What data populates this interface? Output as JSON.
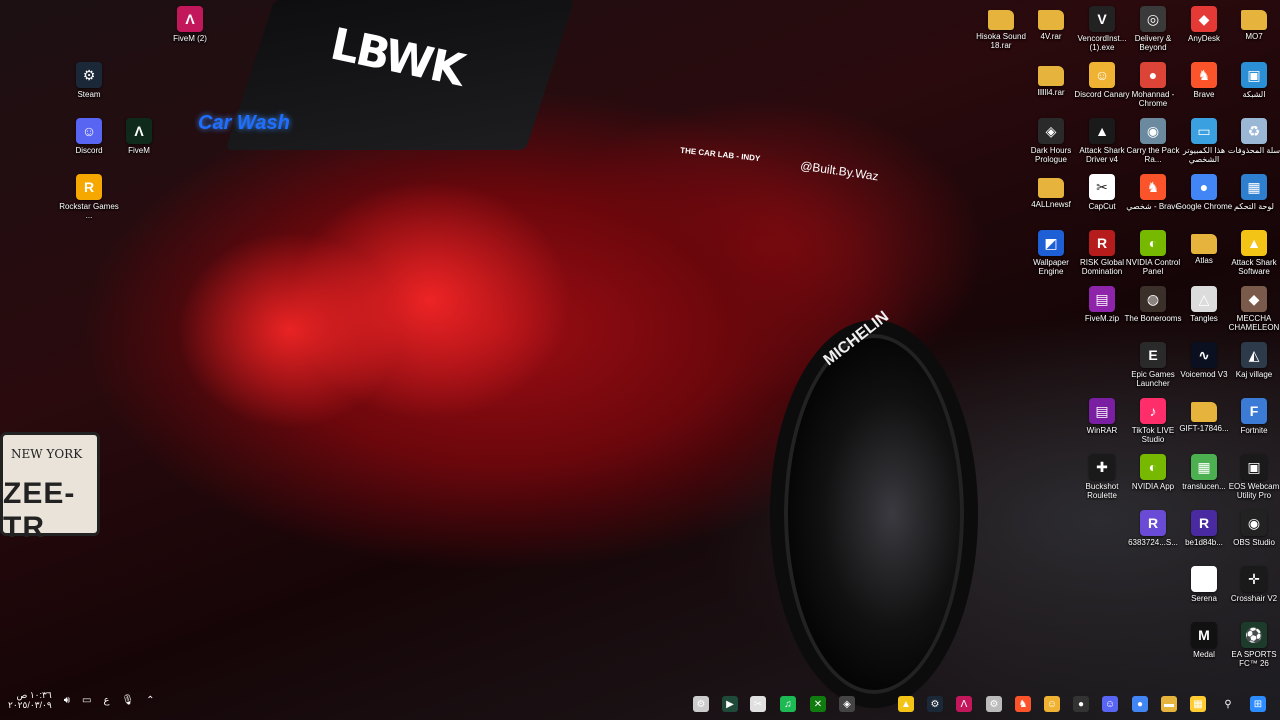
{
  "wallpaper": {
    "decal_brand": "LBWK",
    "decal_handle": "@Built.By.Waz",
    "decal_shop": "THE CAR LAB - INDY",
    "plate_state": "NEW YORK",
    "plate_number": "ZEE-TR",
    "tire_brand": "MICHELIN",
    "neon_sign": "Car Wash"
  },
  "desktop_icons": [
    {
      "id": "fivem2",
      "label": "FiveM (2)",
      "icon": "fivem-icon",
      "color": "#c2185b",
      "glyph": "Λ"
    },
    {
      "id": "steam",
      "label": "Steam",
      "icon": "steam-icon",
      "color": "#1b2838",
      "glyph": "⚙"
    },
    {
      "id": "discord",
      "label": "Discord",
      "icon": "discord-icon",
      "color": "#5865f2",
      "glyph": "☺"
    },
    {
      "id": "fivem",
      "label": "FiveM",
      "icon": "fivem-icon",
      "color": "#0f2a1a",
      "glyph": "Λ"
    },
    {
      "id": "rockstar",
      "label": "Rockstar Games ...",
      "icon": "rockstar-icon",
      "color": "#f6a800",
      "glyph": "R"
    },
    {
      "id": "hisoka",
      "label": "Hisoka Sound 18.rar",
      "icon": "folder-icon",
      "color": "#e6b43c",
      "glyph": ""
    },
    {
      "id": "4v",
      "label": "4V.rar",
      "icon": "folder-icon",
      "color": "#e6b43c",
      "glyph": ""
    },
    {
      "id": "vencord",
      "label": "VencordInst... (1).exe",
      "icon": "vencord-icon",
      "color": "#222222",
      "glyph": "V"
    },
    {
      "id": "delivery",
      "label": "Delivery & Beyond",
      "icon": "delivery-icon",
      "color": "#3a3a3a",
      "glyph": "◎"
    },
    {
      "id": "anydesk",
      "label": "AnyDesk",
      "icon": "anydesk-icon",
      "color": "#e53935",
      "glyph": "◆"
    },
    {
      "id": "mo7",
      "label": "MO7",
      "icon": "folder-icon",
      "color": "#e6b43c",
      "glyph": ""
    },
    {
      "id": "l4rar",
      "label": "llllll4.rar",
      "icon": "folder-icon",
      "color": "#e6b43c",
      "glyph": ""
    },
    {
      "id": "discordcanary",
      "label": "Discord Canary",
      "icon": "discord-canary-icon",
      "color": "#f0b232",
      "glyph": "☺"
    },
    {
      "id": "mohannad",
      "label": "Mohannad - Chrome",
      "icon": "chrome-icon",
      "color": "#db4437",
      "glyph": "●"
    },
    {
      "id": "brave",
      "label": "Brave",
      "icon": "brave-icon",
      "color": "#fb542b",
      "glyph": "♞"
    },
    {
      "id": "network",
      "label": "الشبكة",
      "icon": "network-icon",
      "color": "#2b8fd6",
      "glyph": "▣"
    },
    {
      "id": "darkhours",
      "label": "Dark Hours Prologue",
      "icon": "dark-hours-icon",
      "color": "#2a2a2a",
      "glyph": "◈"
    },
    {
      "id": "attackshark",
      "label": "Attack Shark Driver v4",
      "icon": "attack-shark-icon",
      "color": "#1a1a1a",
      "glyph": "▲"
    },
    {
      "id": "carrythe",
      "label": "Carry the Pack Ra...",
      "icon": "game-icon",
      "color": "#6b8aa0",
      "glyph": "◉"
    },
    {
      "id": "thispc",
      "label": "هذا الكمبيوتر الشخصي",
      "icon": "computer-icon",
      "color": "#3aa0e0",
      "glyph": "▭"
    },
    {
      "id": "recycle",
      "label": "سلة المحذوفات",
      "icon": "recycle-bin-icon",
      "color": "#9ab8d6",
      "glyph": "♻"
    },
    {
      "id": "4allnewsf",
      "label": "4ALLnewsf",
      "icon": "folder-icon",
      "color": "#e6b43c",
      "glyph": ""
    },
    {
      "id": "capcut",
      "label": "CapCut",
      "icon": "capcut-icon",
      "color": "#ffffff",
      "glyph": "✂"
    },
    {
      "id": "shakhsibrave",
      "label": "شخصي - Brave",
      "icon": "brave-icon",
      "color": "#fb542b",
      "glyph": "♞"
    },
    {
      "id": "googlechrome",
      "label": "Google Chrome",
      "icon": "chrome-icon",
      "color": "#4285f4",
      "glyph": "●"
    },
    {
      "id": "controlpanel",
      "label": "لوحة التحكم",
      "icon": "control-panel-icon",
      "color": "#2f7fd0",
      "glyph": "▦"
    },
    {
      "id": "wallpaper",
      "label": "Wallpaper Engine",
      "icon": "wallpaper-engine-icon",
      "color": "#1e5fd6",
      "glyph": "◩"
    },
    {
      "id": "risk",
      "label": "RISK Global Domination",
      "icon": "risk-icon",
      "color": "#b71c1c",
      "glyph": "R"
    },
    {
      "id": "nvidiacp",
      "label": "NVIDIA Control Panel",
      "icon": "nvidia-icon",
      "color": "#76b900",
      "glyph": "◐"
    },
    {
      "id": "atlas",
      "label": "Atlas",
      "icon": "folder-icon",
      "color": "#e6b43c",
      "glyph": ""
    },
    {
      "id": "attacksharksw",
      "label": "Attack Shark Software",
      "icon": "attack-shark-icon",
      "color": "#f3c316",
      "glyph": "▲"
    },
    {
      "id": "fivemzip",
      "label": "FiveM.zip",
      "icon": "zip-icon",
      "color": "#8e24aa",
      "glyph": "▤"
    },
    {
      "id": "boneroom",
      "label": "The Bonerooms",
      "icon": "game-icon",
      "color": "#3b2f2a",
      "glyph": "◍"
    },
    {
      "id": "tangles",
      "label": "Tangles",
      "icon": "tangles-icon",
      "color": "#dcdcdc",
      "glyph": "△"
    },
    {
      "id": "meccha",
      "label": "MECCHA CHAMELEON",
      "icon": "game-icon",
      "color": "#7a5a4a",
      "glyph": "◆"
    },
    {
      "id": "epic",
      "label": "Epic Games Launcher",
      "icon": "epic-icon",
      "color": "#2a2a2a",
      "glyph": "E"
    },
    {
      "id": "voicemod",
      "label": "Voicemod V3",
      "icon": "voicemod-icon",
      "color": "#0b1020",
      "glyph": "∿"
    },
    {
      "id": "kakvillage",
      "label": "Kaj village",
      "icon": "game-icon",
      "color": "#2d3a4a",
      "glyph": "◭"
    },
    {
      "id": "winrar",
      "label": "WinRAR",
      "icon": "winrar-icon",
      "color": "#7b1fa2",
      "glyph": "▤"
    },
    {
      "id": "tiktoklive",
      "label": "TikTok LIVE Studio",
      "icon": "tiktok-icon",
      "color": "#ff2d6a",
      "glyph": "♪"
    },
    {
      "id": "gift",
      "label": "GIFT-17846...",
      "icon": "folder-icon",
      "color": "#e6b43c",
      "glyph": ""
    },
    {
      "id": "fortnite",
      "label": "Fortnite",
      "icon": "fortnite-icon",
      "color": "#3b7bd6",
      "glyph": "F"
    },
    {
      "id": "buckshot",
      "label": "Buckshot Roulette",
      "icon": "buckshot-icon",
      "color": "#1a1a1a",
      "glyph": "✚"
    },
    {
      "id": "nvidiaapp",
      "label": "NVIDIA App",
      "icon": "nvidia-icon",
      "color": "#76b900",
      "glyph": "◐"
    },
    {
      "id": "translucent",
      "label": "translucen...",
      "icon": "translucent-icon",
      "color": "#4caf50",
      "glyph": "▦"
    },
    {
      "id": "eos",
      "label": "EOS Webcam Utility Pro",
      "icon": "eos-icon",
      "color": "#1a1a1a",
      "glyph": "▣"
    },
    {
      "id": "r1",
      "label": "6383724...S...",
      "icon": "reddit-like-icon",
      "color": "#6a4bd6",
      "glyph": "R"
    },
    {
      "id": "r2",
      "label": "be1d84b...",
      "icon": "reddit-like-icon",
      "color": "#4a2aa0",
      "glyph": "R"
    },
    {
      "id": "obs",
      "label": "OBS Studio",
      "icon": "obs-icon",
      "color": "#222222",
      "glyph": "◉"
    },
    {
      "id": "serena",
      "label": "Serena",
      "icon": "document-icon",
      "color": "#ffffff",
      "glyph": ""
    },
    {
      "id": "crosshair",
      "label": "Crosshair V2",
      "icon": "crosshair-icon",
      "color": "#1a1a1a",
      "glyph": "✛"
    },
    {
      "id": "medal",
      "label": "Medal",
      "icon": "medal-icon",
      "color": "#111111",
      "glyph": "M"
    },
    {
      "id": "easports",
      "label": "EA SPORTS FC™ 26",
      "icon": "ea-icon",
      "color": "#1c3b2a",
      "glyph": "⚽"
    }
  ],
  "taskbar": {
    "clock_time": "١٠:٣٦ ص",
    "clock_date": "٢٠٢٥/٠٣/٠٩",
    "lang": "ع",
    "items": [
      {
        "id": "tb-settings",
        "icon": "gear-icon",
        "glyph": "⚙",
        "color": "#cccccc"
      },
      {
        "id": "tb-terminal",
        "icon": "terminal-icon",
        "glyph": "▶",
        "color": "#1f4a3a"
      },
      {
        "id": "tb-snip",
        "icon": "snip-icon",
        "glyph": "✂",
        "color": "#e0e0e0"
      },
      {
        "id": "tb-spotify",
        "icon": "spotify-icon",
        "glyph": "♫",
        "color": "#1db954"
      },
      {
        "id": "tb-xbox",
        "icon": "xbox-icon",
        "glyph": "✕",
        "color": "#107c10"
      },
      {
        "id": "tb-gamebar",
        "icon": "controller-icon",
        "glyph": "◈",
        "color": "#444444"
      },
      {
        "id": "tb-shark",
        "icon": "attack-shark-icon",
        "glyph": "▲",
        "color": "#f3c316"
      },
      {
        "id": "tb-steam",
        "icon": "steam-icon",
        "glyph": "⚙",
        "color": "#1b2838"
      },
      {
        "id": "tb-fivem",
        "icon": "fivem-icon",
        "glyph": "Λ",
        "color": "#c2185b"
      },
      {
        "id": "tb-settings2",
        "icon": "gear-icon",
        "glyph": "⚙",
        "color": "#bbbbbb"
      },
      {
        "id": "tb-brave",
        "icon": "brave-icon",
        "glyph": "♞",
        "color": "#fb542b"
      },
      {
        "id": "tb-canary",
        "icon": "discord-canary-icon",
        "glyph": "☺",
        "color": "#f0b232"
      },
      {
        "id": "tb-record",
        "icon": "record-icon",
        "glyph": "●",
        "color": "#333333"
      },
      {
        "id": "tb-discord",
        "icon": "discord-icon",
        "glyph": "☺",
        "color": "#5865f2"
      },
      {
        "id": "tb-chrome",
        "icon": "chrome-icon",
        "glyph": "●",
        "color": "#4285f4"
      },
      {
        "id": "tb-explorer",
        "icon": "folder-icon",
        "glyph": "▬",
        "color": "#e6b43c"
      },
      {
        "id": "tb-store",
        "icon": "store-icon",
        "glyph": "▦",
        "color": "#ffcc33"
      },
      {
        "id": "tb-search",
        "icon": "search-icon",
        "glyph": "⚲",
        "color": "transparent"
      },
      {
        "id": "tb-start",
        "icon": "windows-start-icon",
        "glyph": "⊞",
        "color": "#2d8cff"
      }
    ]
  }
}
